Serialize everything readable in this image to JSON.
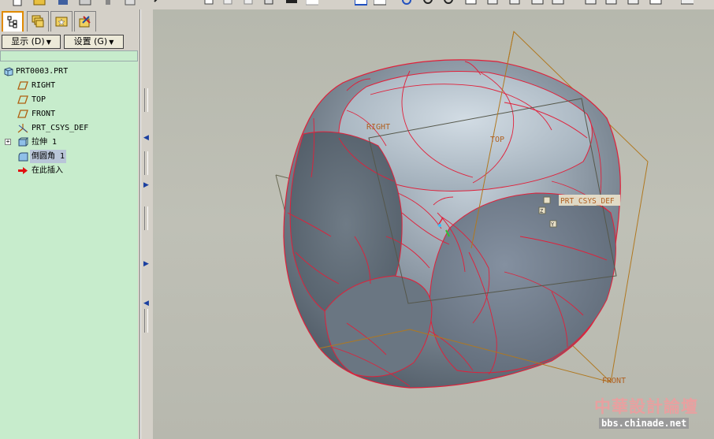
{
  "nav_tabs": [
    {
      "icon": "model-tree-icon",
      "active": true
    },
    {
      "icon": "layers-icon",
      "active": false
    },
    {
      "icon": "folder-browser-icon",
      "active": false
    },
    {
      "icon": "favorites-icon",
      "active": false
    }
  ],
  "model_tree_toolbar": {
    "show_label": "显示",
    "show_key": "(D)",
    "settings_label": "设置",
    "settings_key": "(G)"
  },
  "model_tree": {
    "items": [
      {
        "label": "PRT0003.PRT",
        "icon": "part-icon",
        "depth": 0
      },
      {
        "label": "RIGHT",
        "icon": "datum-plane-icon",
        "depth": 1
      },
      {
        "label": "TOP",
        "icon": "datum-plane-icon",
        "depth": 1
      },
      {
        "label": "FRONT",
        "icon": "datum-plane-icon",
        "depth": 1
      },
      {
        "label": "PRT_CSYS_DEF",
        "icon": "coordinate-system-icon",
        "depth": 1
      },
      {
        "label": "拉伸 1",
        "icon": "extrude-icon",
        "depth": 1,
        "expandable": true
      },
      {
        "label": "倒圆角 1",
        "icon": "round-icon",
        "depth": 1,
        "selected": true
      },
      {
        "label": "在此插入",
        "icon": "insert-here-arrow-icon",
        "depth": 1
      }
    ]
  },
  "viewport": {
    "datum_labels": {
      "right": "RIGHT",
      "top": "TOP",
      "front": "FRONT",
      "csys": "PRT_CSYS_DEF",
      "csys_z": "Z",
      "csys_y": "Y"
    }
  },
  "watermark": {
    "title": "中華設計論壇",
    "url": "bbs.chinade.net"
  },
  "colors": {
    "tree_background": "#c7eccc",
    "edge_highlight": "#e0203a",
    "datum_plane": "#b07820",
    "active_tab": "#e08a00"
  }
}
